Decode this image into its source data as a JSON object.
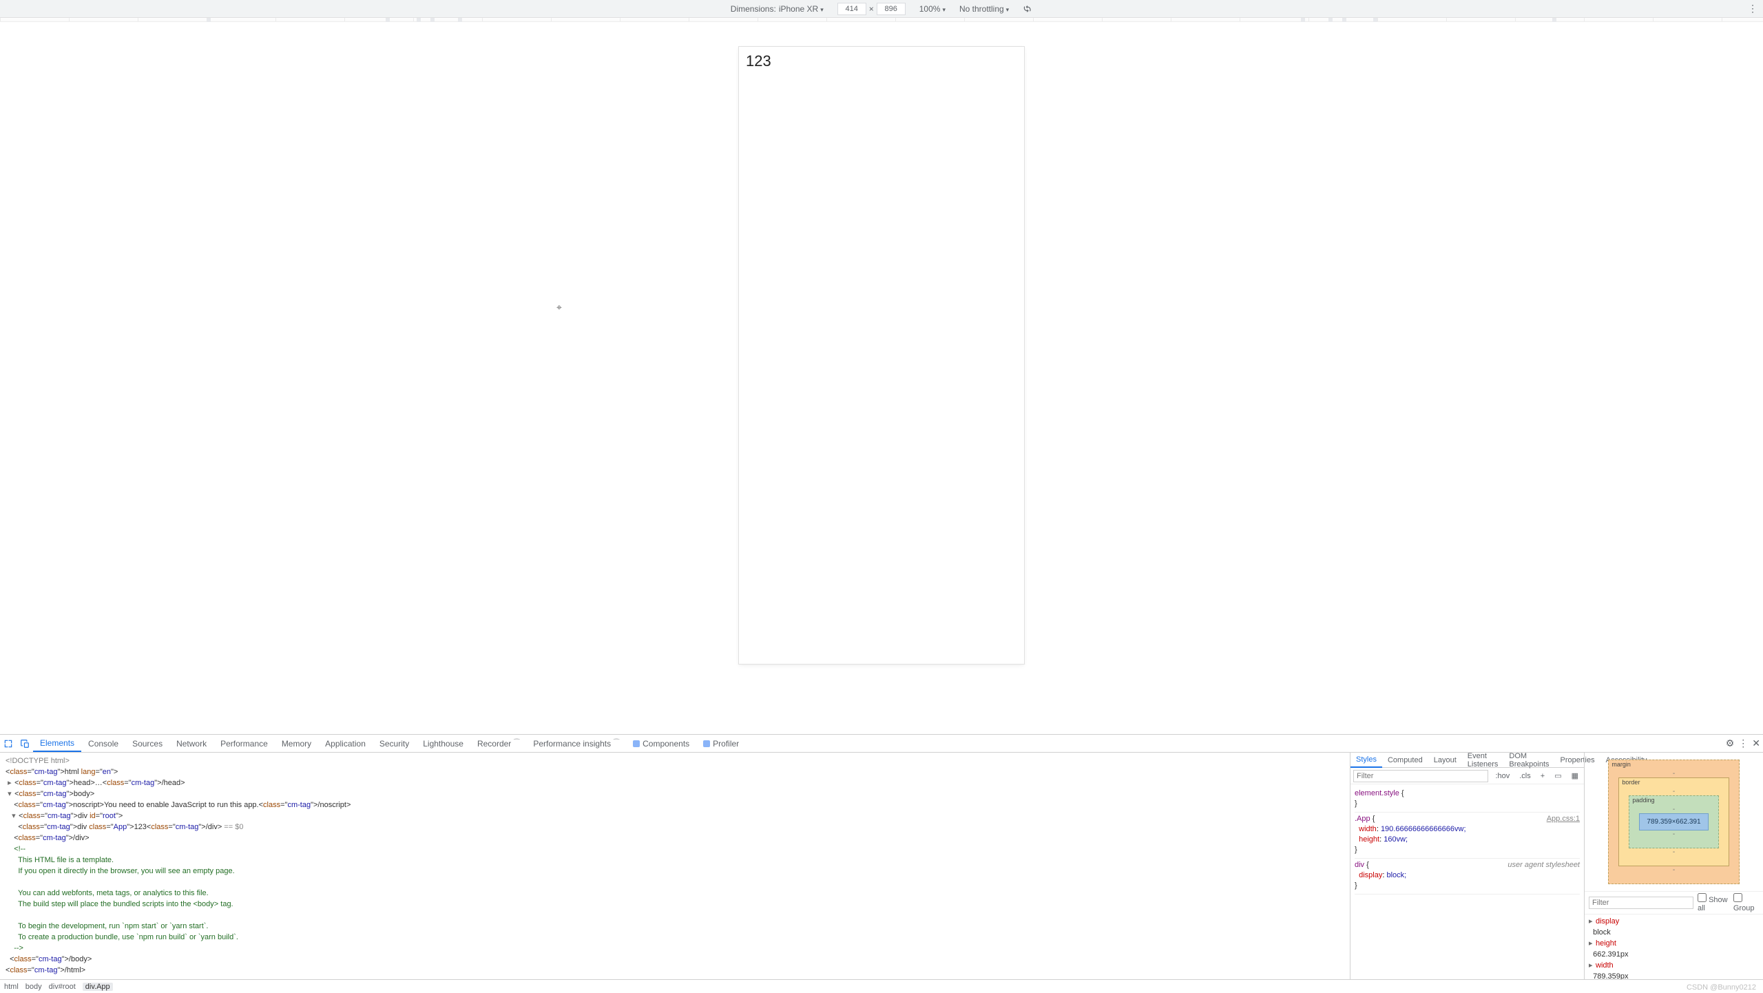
{
  "deviceBar": {
    "label": "Dimensions:",
    "device": "iPhone XR",
    "width": "414",
    "sep": "×",
    "height": "896",
    "zoom": "100%",
    "throttling": "No throttling"
  },
  "app": {
    "content": "123"
  },
  "devtools": {
    "tabs": [
      "Elements",
      "Console",
      "Sources",
      "Network",
      "Performance",
      "Memory",
      "Application",
      "Security",
      "Lighthouse",
      "Recorder",
      "Performance insights",
      "Components",
      "Profiler"
    ],
    "activeTab": "Elements",
    "sideTabs": [
      "Styles",
      "Computed",
      "Layout",
      "Event Listeners",
      "DOM Breakpoints",
      "Properties",
      "Accessibility"
    ],
    "activeSideTab": "Styles"
  },
  "elementsTree": {
    "doctype": "<!DOCTYPE html>",
    "htmlOpen": "<html lang=\"en\">",
    "headLine": "<head>…</head>",
    "bodyOpen": "<body>",
    "noscript": "You need to enable JavaScript to run this app.",
    "rootOpen": "<div id=\"root\">",
    "appLine": "<div class=\"App\">123</div>",
    "eqSuffix": " == $0",
    "divClose": "</div>",
    "commentLines": [
      "This HTML file is a template.",
      "If you open it directly in the browser, you will see an empty page.",
      "",
      "You can add webfonts, meta tags, or analytics to this file.",
      "The build step will place the bundled scripts into the <body> tag.",
      "",
      "To begin the development, run `npm start` or `yarn start`.",
      "To create a production bundle, use `npm run build` or `yarn build`."
    ],
    "bodyClose": "</body>",
    "htmlClose": "</html>"
  },
  "breadcrumbs": [
    "html",
    "body",
    "div#root",
    "div.App"
  ],
  "stylesToolbar": {
    "filterPlaceholder": "Filter",
    "hov": ":hov",
    "cls": ".cls",
    "plus": "+"
  },
  "stylesRules": {
    "elementStyle": {
      "selector": "element.style",
      "decls": []
    },
    "appRule": {
      "selector": ".App",
      "origin": "App.css:1",
      "decls": [
        {
          "prop": "width",
          "val": "190.66666666666666vw;"
        },
        {
          "prop": "height",
          "val": "160vw;"
        }
      ]
    },
    "divRule": {
      "selector": "div",
      "ua": "user agent stylesheet",
      "decls": [
        {
          "prop": "display",
          "val": "block;"
        }
      ]
    }
  },
  "boxModel": {
    "marginLabel": "margin",
    "borderLabel": "border",
    "paddingLabel": "padding",
    "content": "789.359×662.391",
    "dash": "-"
  },
  "computedFilter": {
    "placeholder": "Filter",
    "showAll": "Show all",
    "group": "Group"
  },
  "computedList": [
    {
      "k": "display",
      "v": "block"
    },
    {
      "k": "height",
      "v": "662.391px"
    },
    {
      "k": "width",
      "v": "789.359px"
    }
  ],
  "watermark": "CSDN @Bunny0212"
}
